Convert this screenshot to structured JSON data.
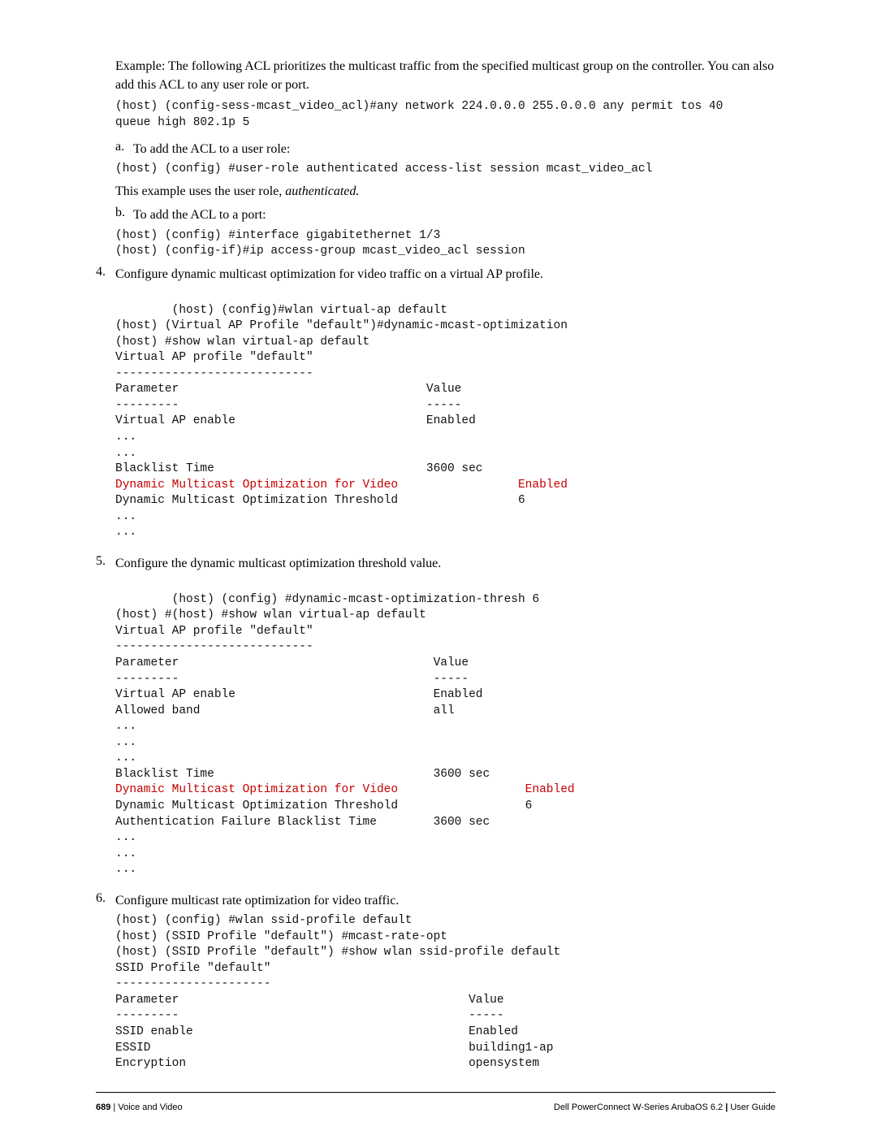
{
  "intro": {
    "p1": "Example: The following ACL prioritizes the multicast traffic from the specified multicast group on the controller. You can also add this ACL to any user role or port.",
    "code1": "(host) (config-sess-mcast_video_acl)#any network 224.0.0.0 255.0.0.0 any permit tos 40\nqueue high 802.1p 5",
    "a_label": "a.",
    "a_text": "To add the ACL to a user role:",
    "a_code": "(host) (config) #user-role authenticated access-list session mcast_video_acl",
    "a_after_pre": "This example uses the user role, ",
    "a_after_em": "authenticated.",
    "b_label": "b.",
    "b_text": "To add the ACL to a port:",
    "b_code": "(host) (config) #interface gigabitethernet 1/3\n(host) (config-if)#ip access-group mcast_video_acl session"
  },
  "step4": {
    "num": "4.",
    "text": "Configure dynamic multicast optimization for video traffic on a virtual AP profile.",
    "code_a": "(host) (config)#wlan virtual-ap default\n(host) (Virtual AP Profile \"default\")#dynamic-mcast-optimization\n(host) #show wlan virtual-ap default\nVirtual AP profile \"default\"\n----------------------------\nParameter                                   Value\n---------                                   -----\nVirtual AP enable                           Enabled\n...\n...\nBlacklist Time                              3600 sec",
    "code_red": "Dynamic Multicast Optimization for Video                 Enabled",
    "code_b": "Dynamic Multicast Optimization Threshold                 6\n...\n..."
  },
  "step5": {
    "num": "5.",
    "text": "Configure the dynamic multicast optimization threshold value.",
    "code_a": "(host) (config) #dynamic-mcast-optimization-thresh 6\n(host) #(host) #show wlan virtual-ap default\nVirtual AP profile \"default\"\n----------------------------\nParameter                                    Value\n---------                                    -----\nVirtual AP enable                            Enabled\nAllowed band                                 all\n...\n...\n...\nBlacklist Time                               3600 sec",
    "code_red": "Dynamic Multicast Optimization for Video                  Enabled",
    "code_b": "Dynamic Multicast Optimization Threshold                  6\nAuthentication Failure Blacklist Time        3600 sec\n...\n...\n..."
  },
  "step6": {
    "num": "6.",
    "text": "Configure multicast rate optimization for video traffic.",
    "code": "(host) (config) #wlan ssid-profile default\n(host) (SSID Profile \"default\") #mcast-rate-opt\n(host) (SSID Profile \"default\") #show wlan ssid-profile default\nSSID Profile \"default\"\n----------------------\nParameter                                         Value\n---------                                         -----\nSSID enable                                       Enabled\nESSID                                             building1-ap\nEncryption                                        opensystem"
  },
  "footer": {
    "page_no": "689",
    "section": "Voice and Video",
    "product": "Dell PowerConnect W-Series ArubaOS 6.2",
    "doc": "User Guide"
  }
}
